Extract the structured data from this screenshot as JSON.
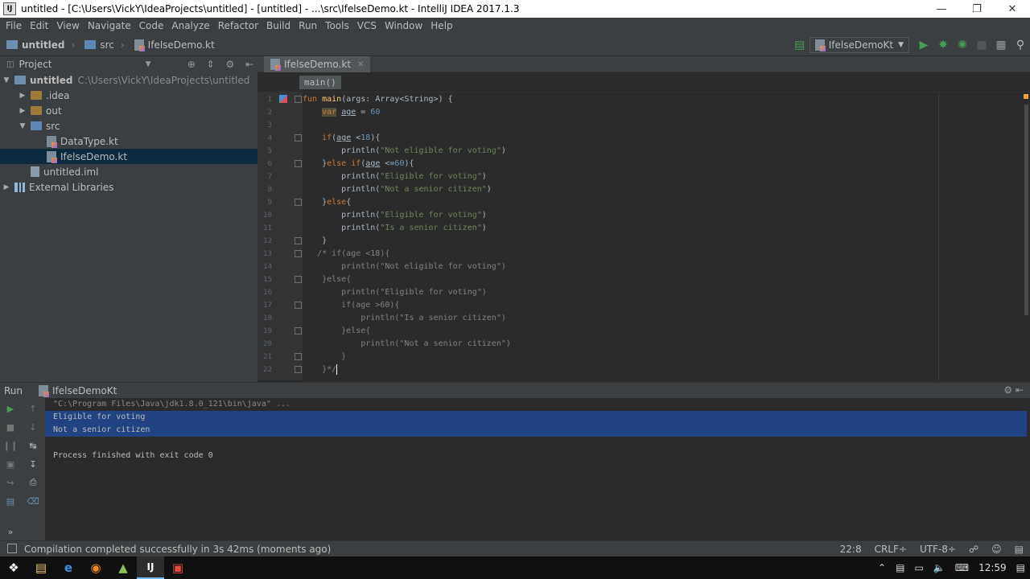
{
  "window": {
    "title": "untitled - [C:\\Users\\VickY\\IdeaProjects\\untitled] - [untitled] - ...\\src\\IfelseDemo.kt - IntelliJ IDEA 2017.1.3"
  },
  "menu": [
    "File",
    "Edit",
    "View",
    "Navigate",
    "Code",
    "Analyze",
    "Refactor",
    "Build",
    "Run",
    "Tools",
    "VCS",
    "Window",
    "Help"
  ],
  "breadcrumbs": [
    "untitled",
    "src",
    "IfelseDemo.kt"
  ],
  "run_config": "IfelseDemoKt",
  "project_panel": {
    "title": "Project",
    "tree": [
      {
        "label": "untitled",
        "path": "C:\\Users\\VickY\\IdeaProjects\\untitled",
        "depth": 0,
        "open": true,
        "icon": "folder-icon"
      },
      {
        "label": ".idea",
        "depth": 1,
        "open": false,
        "icon": "folder-icon"
      },
      {
        "label": "out",
        "depth": 1,
        "open": false,
        "icon": "folder-icon"
      },
      {
        "label": "src",
        "depth": 1,
        "open": true,
        "icon": "folder-icon"
      },
      {
        "label": "DataType.kt",
        "depth": 2,
        "icon": "kotlin-file-icon"
      },
      {
        "label": "IfelseDemo.kt",
        "depth": 2,
        "icon": "kotlin-file-icon",
        "selected": true
      },
      {
        "label": "untitled.iml",
        "depth": 1,
        "icon": "module-file-icon"
      },
      {
        "label": "External Libraries",
        "depth": 0,
        "open": false,
        "icon": "library-icon"
      }
    ]
  },
  "editor": {
    "tab_label": "IfelseDemo.kt",
    "breadcrumb": "main()",
    "line_numbers": [
      "1",
      "2",
      "3",
      "4",
      "5",
      "6",
      "7",
      "8",
      "9",
      "10",
      "11",
      "12",
      "13",
      "14",
      "15",
      "16",
      "17",
      "18",
      "19",
      "20",
      "21",
      "22"
    ]
  },
  "run_panel": {
    "label": "Run",
    "config": "IfelseDemoKt",
    "console": [
      "\"C:\\Program Files\\Java\\jdk1.8.0_121\\bin\\java\" ...",
      "Eligible for voting",
      "Not a senior citizen",
      "",
      "Process finished with exit code 0"
    ]
  },
  "status": {
    "message": "Compilation completed successfully in 3s 42ms (moments ago)",
    "position": "22:8",
    "line_sep": "CRLF÷",
    "encoding": "UTF-8÷"
  },
  "taskbar": {
    "time": "12:59"
  }
}
